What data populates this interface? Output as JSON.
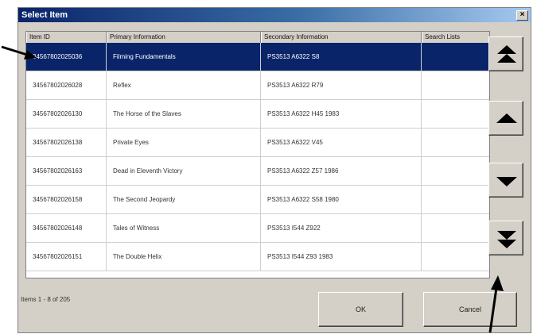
{
  "window": {
    "title": "Select Item",
    "close_label": "×"
  },
  "list": {
    "columns": [
      "Item ID",
      "Primary Information",
      "Secondary Information",
      "Search Lists"
    ],
    "rows": [
      {
        "id": "34567802025036",
        "primary": "Filming Fundamentals",
        "secondary": "PS3513 A6322 S8",
        "search": "",
        "selected": true
      },
      {
        "id": "34567802026028",
        "primary": "Reflex",
        "secondary": "PS3513 A6322 R79",
        "search": "",
        "selected": false
      },
      {
        "id": "34567802026130",
        "primary": "The Horse of the Slaves",
        "secondary": "PS3513 A6322 H45 1983",
        "search": "",
        "selected": false
      },
      {
        "id": "34567802026138",
        "primary": "Private Eyes",
        "secondary": "PS3513 A6322 V45",
        "search": "",
        "selected": false
      },
      {
        "id": "34567802026163",
        "primary": "Dead in Eleventh Victory",
        "secondary": "PS3513 A6322 Z57 1986",
        "search": "",
        "selected": false
      },
      {
        "id": "34567802026158",
        "primary": "The Second Jeopardy",
        "secondary": "PS3513 A6322 S58 1980",
        "search": "",
        "selected": false
      },
      {
        "id": "34567802026148",
        "primary": "Tales of Witness",
        "secondary": "PS3513 I544 Z922",
        "search": "",
        "selected": false
      },
      {
        "id": "34567802026151",
        "primary": "The Double Helix",
        "secondary": "PS3513 I544 Z93 1983",
        "search": "",
        "selected": false
      }
    ]
  },
  "status": {
    "text": "Items 1 - 8 of 205"
  },
  "buttons": {
    "ok": "OK",
    "cancel": "Cancel"
  },
  "colors": {
    "selection": "#0a246a",
    "dialog": "#d4d0c8"
  }
}
